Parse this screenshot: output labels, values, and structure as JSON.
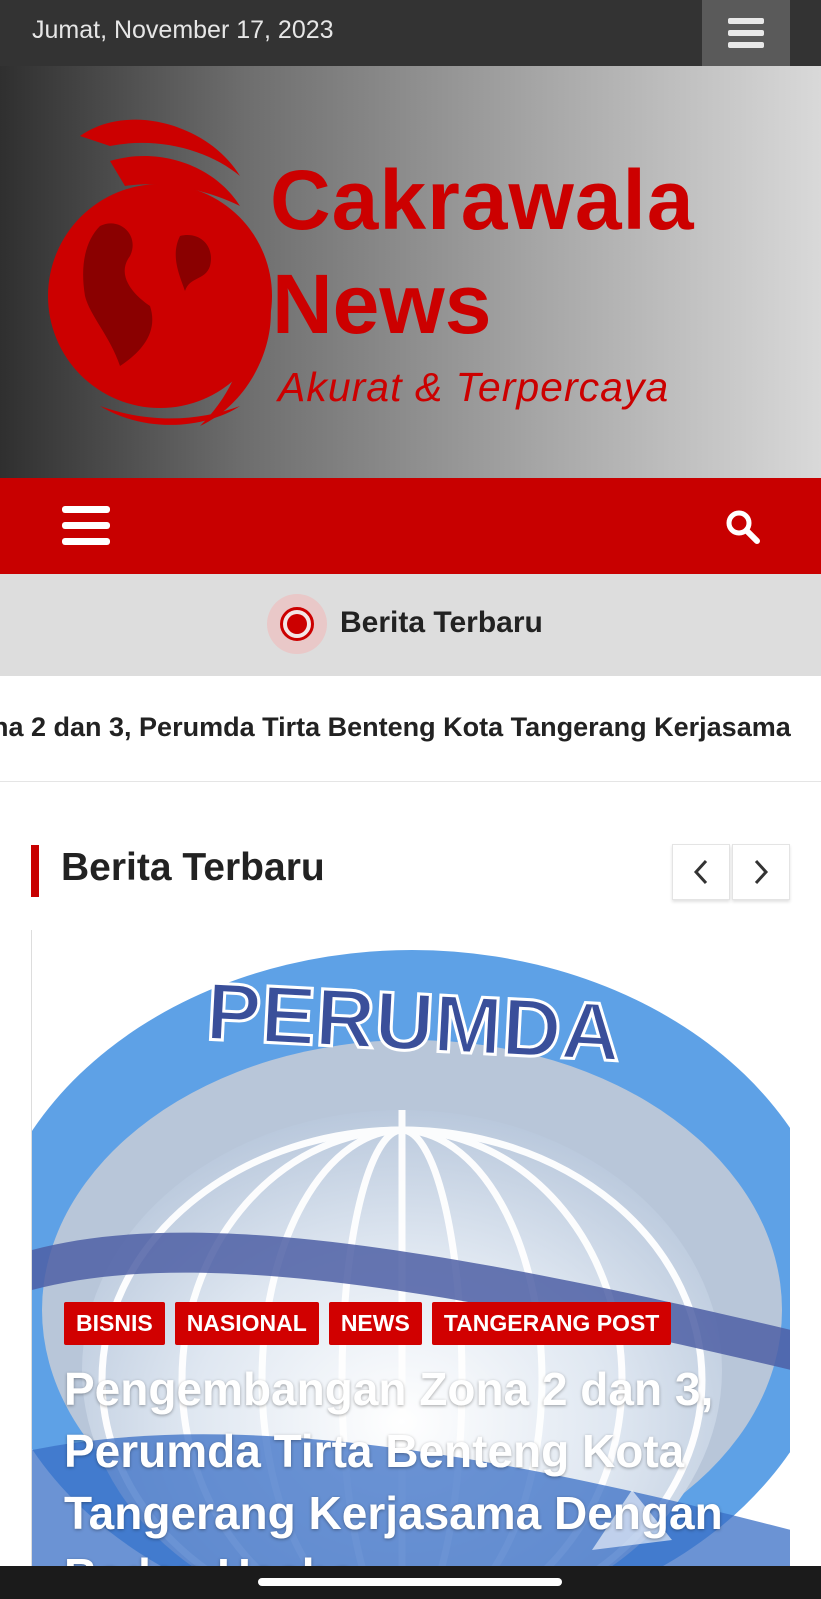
{
  "topbar": {
    "date": "Jumat, November 17, 2023",
    "menu_icon": "hamburger-icon"
  },
  "header": {
    "brand_line1": "Cakrawala",
    "brand_line2": "News",
    "tagline": "Akurat & Terpercaya",
    "brand_color": "#cc0000"
  },
  "navbar": {
    "menu_icon": "hamburger-icon",
    "search_icon": "search-icon",
    "bg_color": "#c80000"
  },
  "ticker": {
    "label": "Berita Terbaru",
    "text": "na 2 dan 3, Perumda Tirta Benteng Kota Tangerang Kerjasama"
  },
  "section": {
    "title": "Berita Terbaru",
    "prev_icon": "chevron-left-icon",
    "next_icon": "chevron-right-icon"
  },
  "featured": {
    "image_text": "PERUMDA",
    "categories": [
      "BISNIS",
      "NASIONAL",
      "NEWS",
      "TANGERANG POST"
    ],
    "headline": "Pengembangan Zona 2 dan 3, Perumda Tirta Benteng Kota Tangerang Kerjasama Dengan Badan Usaha"
  }
}
